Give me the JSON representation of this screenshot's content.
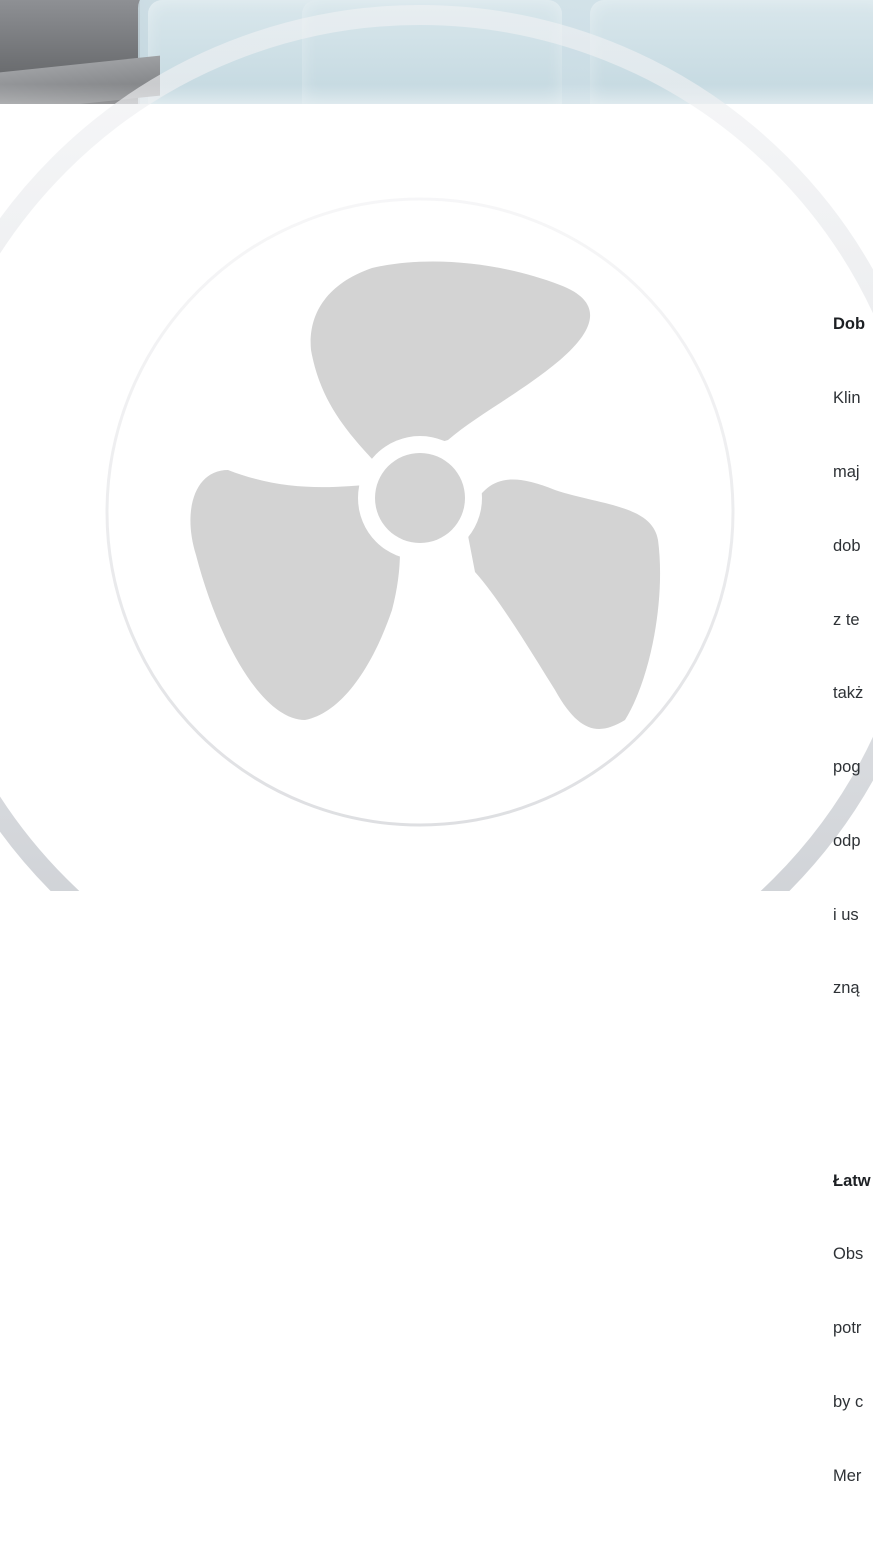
{
  "hero_image": {
    "icon": "living-room-photo"
  },
  "decoration": {
    "icon": "fan-icon",
    "fan_color": "#d3d3d3",
    "ring_color": "#e6e6e8"
  },
  "sections": [
    {
      "heading": "Dob",
      "lines": [
        "Klin",
        "maj",
        "dob",
        "z te",
        "takż",
        "pog",
        "odp",
        "i us",
        "zną"
      ]
    },
    {
      "heading": "Łatw",
      "lines": [
        "Obs",
        "potr",
        "by c",
        "Mer"
      ]
    }
  ]
}
